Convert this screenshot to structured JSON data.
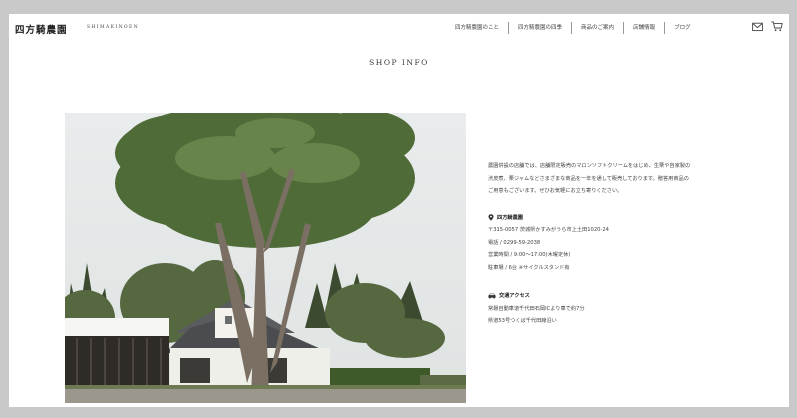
{
  "header": {
    "logo": "四方騎農園",
    "logo_sub": "SHIMAKINOEN",
    "nav": [
      "四方騎農園のこと",
      "四方騎農園の四季",
      "商品のご案内",
      "店舗情報",
      "ブログ"
    ]
  },
  "page_title": "SHOP INFO",
  "intro": [
    "農園併設の店舗では、店舗限定販売のマロンソフトクリームをはじめ、生栗や自家製の",
    "渋皮煮、栗ジャムなどさまざまな商品を一年を通して販売しております。贈答用商品の",
    "ご用意もございます。ぜひお気軽にお立ち寄りください。"
  ],
  "shop": {
    "name": "四方騎農園",
    "address": "〒315-0057 茨城県かすみがうら市上土田1020-24",
    "phone": "電話 / 0299-59-2038",
    "hours": "営業時間 / 9:00～17:00(木曜定休)",
    "parking": "駐車場 / 6台 ※サイクルスタンド有"
  },
  "access": {
    "title": "交通アクセス",
    "lines": [
      "常磐自動車道千代田石岡ICより車で約7分",
      "県道53号つくば千代田線沿い"
    ]
  },
  "icons": {
    "mail": "mail-icon",
    "cart": "cart-icon",
    "location": "location-pin-icon",
    "car": "car-icon"
  }
}
